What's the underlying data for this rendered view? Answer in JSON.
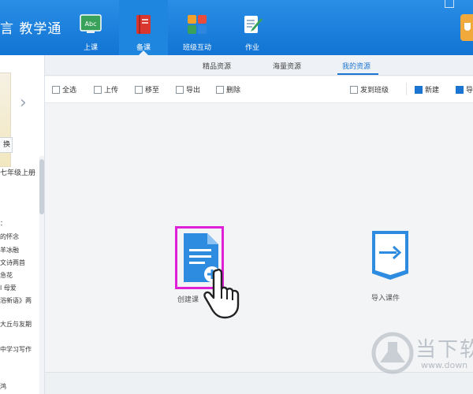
{
  "app": {
    "title": "言 教学通"
  },
  "nav": [
    {
      "label": "上课",
      "icon": "blackboard-abc-icon"
    },
    {
      "label": "备课",
      "icon": "book-icon"
    },
    {
      "label": "班级互动",
      "icon": "class-interaction-icon"
    },
    {
      "label": "作业",
      "icon": "homework-pencil-icon"
    }
  ],
  "left": {
    "book_button": "换",
    "grade": "七年级上册",
    "lessons": [
      "：",
      "的怀念",
      "羊冰融",
      "文诗两首",
      "急花",
      "l 母爱",
      "浴新语》两",
      "",
      "大丘与友期",
      "",
      "中学习写作",
      "",
      "鸿"
    ]
  },
  "tabs": [
    "精品资源",
    "海量资源",
    "我的资源"
  ],
  "toolbar": {
    "select_all": "全选",
    "upload": "上传",
    "move": "移至",
    "export": "导出",
    "delete": "删除",
    "send_to_class": "发到班级",
    "new": "新建",
    "more": "导"
  },
  "content": {
    "create_label": "创建课",
    "import_label": "导入课件"
  },
  "watermark": {
    "text": "当下软",
    "url": "www.down"
  },
  "colors": {
    "brand_blue": "#1b74d2",
    "highlight_magenta": "#e020d6",
    "icon_blue": "#2d8be0"
  }
}
